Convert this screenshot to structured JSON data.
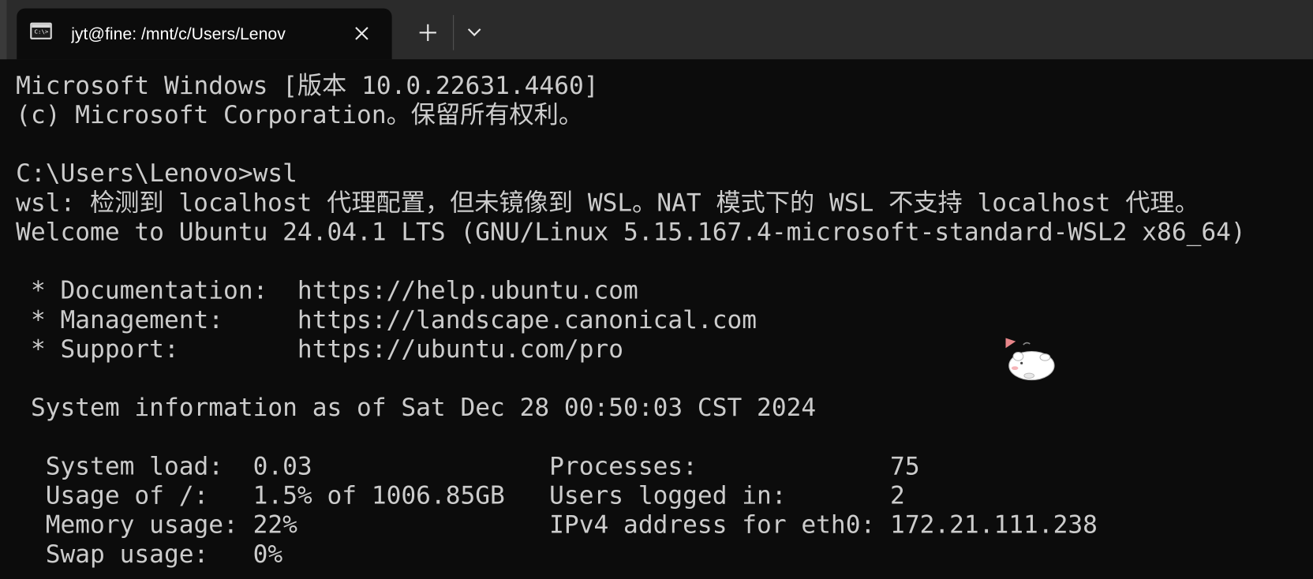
{
  "window": {
    "tab": {
      "icon": "terminal-icon",
      "icon_glyph": "C:\\>",
      "title": "jyt@fine: /mnt/c/Users/Lenov",
      "close_icon": "close-icon"
    },
    "new_tab_icon": "plus-icon",
    "dropdown_icon": "chevron-down-icon"
  },
  "terminal": {
    "lines": [
      "Microsoft Windows [版本 10.0.22631.4460]",
      "(c) Microsoft Corporation。保留所有权利。",
      "",
      "C:\\Users\\Lenovo>wsl",
      "wsl: 检测到 localhost 代理配置，但未镜像到 WSL。NAT 模式下的 WSL 不支持 localhost 代理。",
      "Welcome to Ubuntu 24.04.1 LTS (GNU/Linux 5.15.167.4-microsoft-standard-WSL2 x86_64)",
      "",
      " * Documentation:  https://help.ubuntu.com",
      " * Management:     https://landscape.canonical.com",
      " * Support:        https://ubuntu.com/pro",
      "",
      " System information as of Sat Dec 28 00:50:03 CST 2024",
      "",
      "  System load:  0.03                Processes:             75",
      "  Usage of /:   1.5% of 1006.85GB   Users logged in:       2",
      "  Memory usage: 22%                 IPv4 address for eth0: 172.21.111.238",
      "  Swap usage:   0%"
    ]
  },
  "sticker_icon": "hamster-sticker-icon",
  "colors": {
    "terminal_bg": "#0c0c0c",
    "terminal_fg": "#cccccc",
    "titlebar_bg": "#2b2b2b",
    "tab_bg": "#0c0c0c"
  }
}
